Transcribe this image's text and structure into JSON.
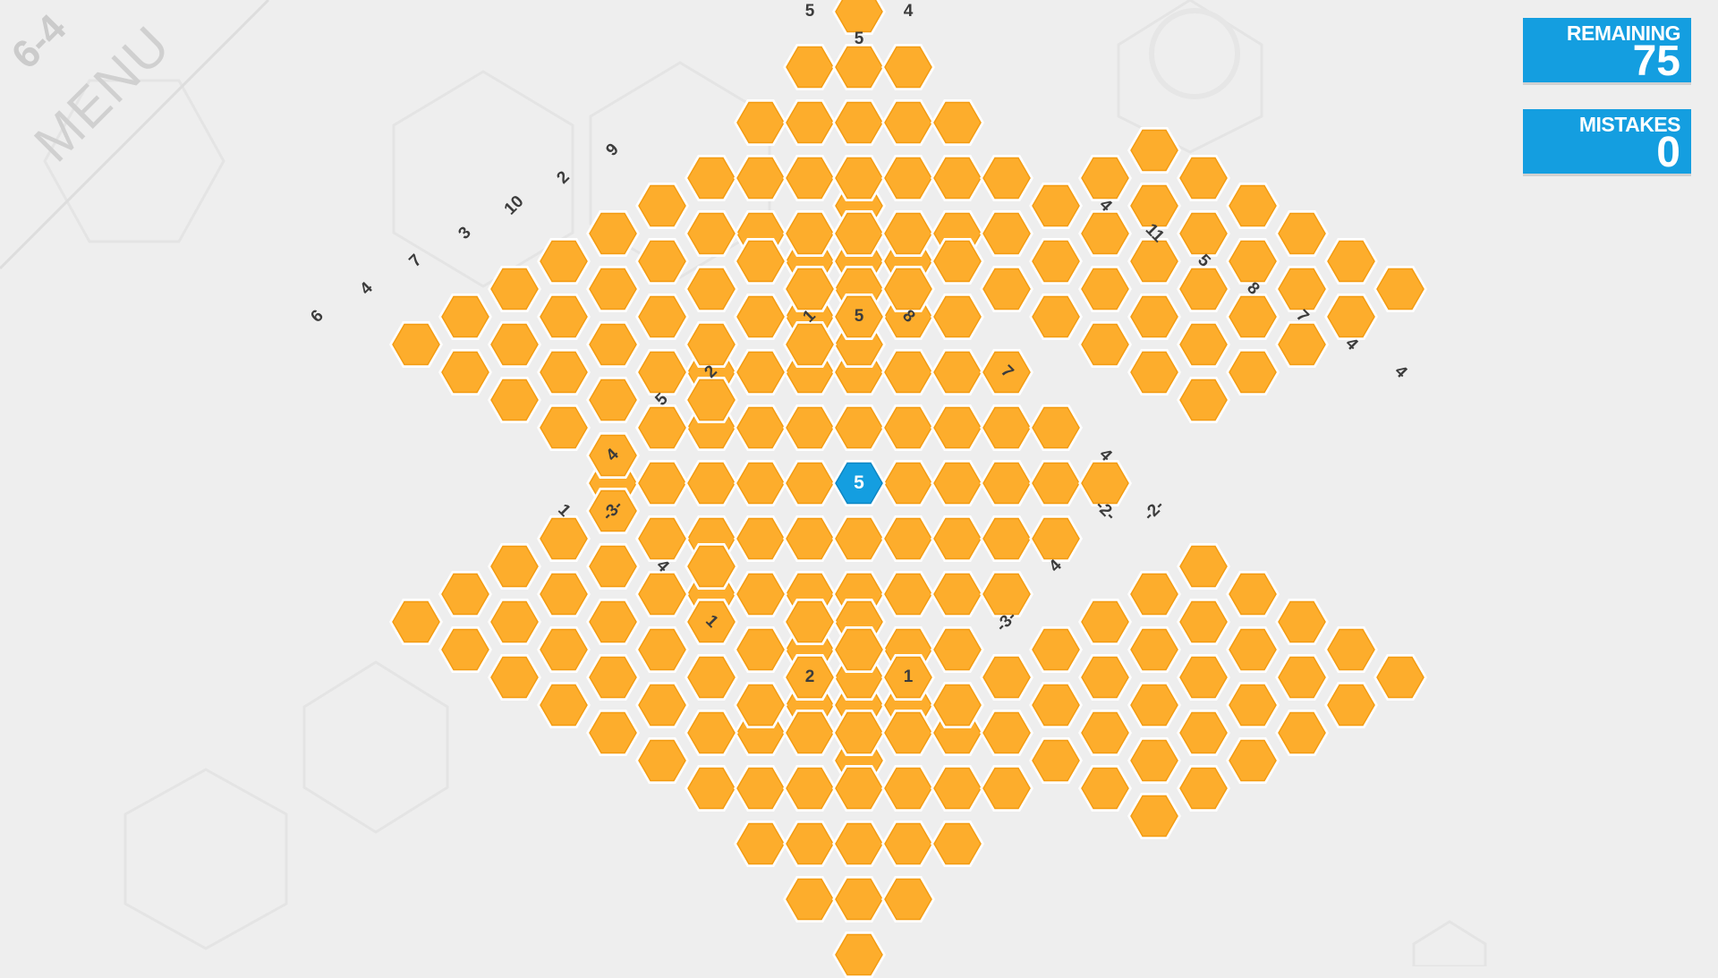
{
  "menu": {
    "level": "6-4",
    "label": "MENU"
  },
  "stats": {
    "remaining_label": "REMAINING",
    "remaining_value": "75",
    "mistakes_label": "MISTAKES",
    "mistakes_value": "0"
  },
  "colors": {
    "hidden_cell": "#fdad2c",
    "revealed_cell": "#149ee0",
    "panel": "#149ee0",
    "background": "#eeeeee"
  },
  "revealed_cell": {
    "value": "5"
  },
  "clues": [
    "5",
    "4",
    "5",
    "9",
    "2",
    "10",
    "3",
    "7",
    "4",
    "6",
    "1",
    "5",
    "8",
    "2",
    "5",
    "7",
    "4",
    "-3-",
    "4",
    "-2-",
    "1",
    "4",
    "1",
    "-2-",
    "4",
    "-3-",
    "2",
    "1",
    "4",
    "11",
    "5",
    "8",
    "7",
    "4",
    "4"
  ]
}
